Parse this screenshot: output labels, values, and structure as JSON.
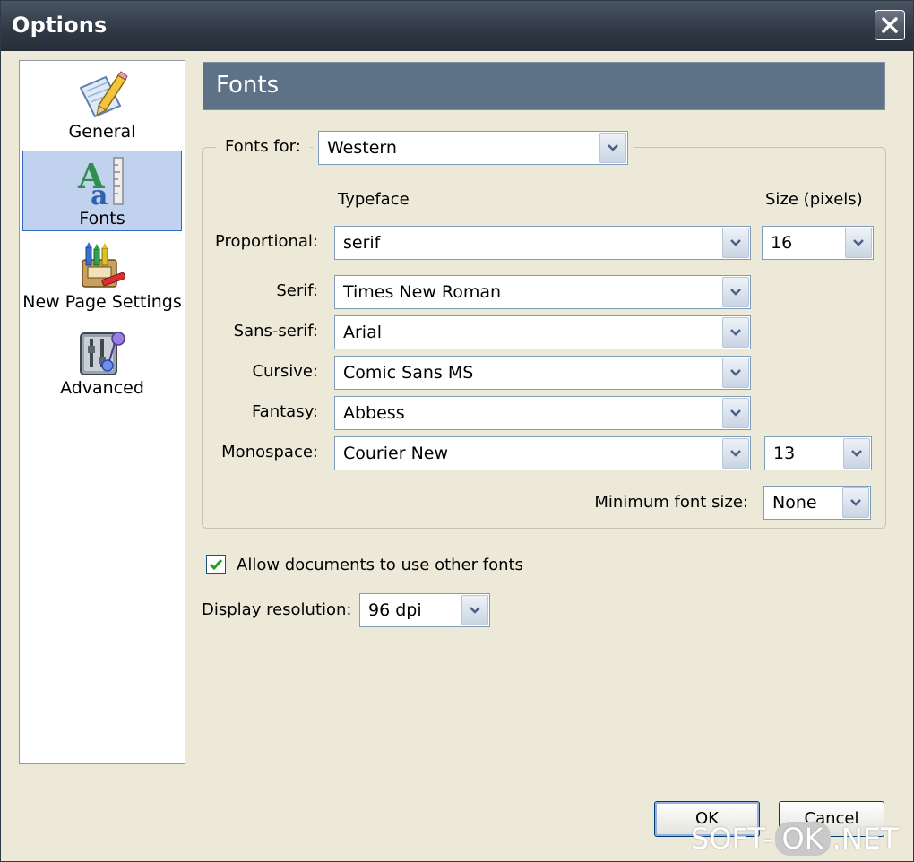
{
  "window": {
    "title": "Options",
    "close_glyph": "✕"
  },
  "sidebar": {
    "items": [
      {
        "label": "General",
        "icon": "pencil-paper-icon",
        "selected": false
      },
      {
        "label": "Fonts",
        "icon": "fonts-icon",
        "selected": true
      },
      {
        "label": "New Page Settings",
        "icon": "crayons-icon",
        "selected": false
      },
      {
        "label": "Advanced",
        "icon": "advanced-settings-icon",
        "selected": false
      }
    ]
  },
  "panel": {
    "title": "Fonts",
    "fonts_for": {
      "label": "Fonts for:",
      "value": "Western"
    },
    "headers": {
      "typeface": "Typeface",
      "size": "Size (pixels)"
    },
    "rows": {
      "proportional": {
        "label": "Proportional:",
        "value": "serif",
        "size": "16"
      },
      "serif": {
        "label": "Serif:",
        "value": "Times New Roman"
      },
      "sans_serif": {
        "label": "Sans-serif:",
        "value": "Arial"
      },
      "cursive": {
        "label": "Cursive:",
        "value": "Comic Sans MS"
      },
      "fantasy": {
        "label": "Fantasy:",
        "value": "Abbess"
      },
      "monospace": {
        "label": "Monospace:",
        "value": "Courier New",
        "size": "13"
      }
    },
    "min_font_size": {
      "label": "Minimum font size:",
      "value": "None"
    },
    "allow_other_fonts": {
      "label": "Allow documents to use other fonts",
      "checked": true
    },
    "display_resolution": {
      "label": "Display resolution:",
      "value": "96 dpi"
    }
  },
  "buttons": {
    "ok": "OK",
    "cancel": "Cancel"
  },
  "watermark": {
    "left": "SOFT-",
    "middle": "OK",
    "right": ".NET"
  },
  "colors": {
    "title_bar": "#2f3845",
    "section_header": "#5d7287",
    "selection": "#c1d2ee",
    "selection_border": "#316ac5"
  }
}
